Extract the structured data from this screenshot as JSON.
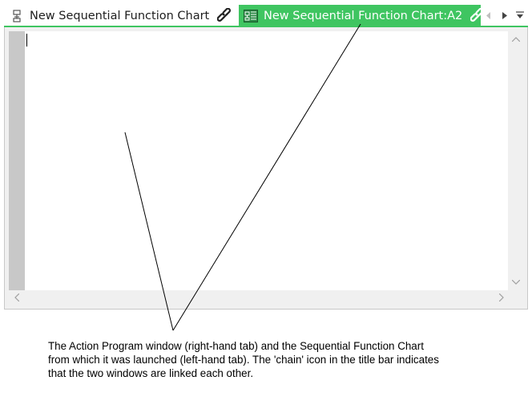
{
  "tabs": [
    {
      "label": "New Sequential Function Chart",
      "icon": "sfc-diagram-icon",
      "link_icon": "chain-link-icon",
      "active": false
    },
    {
      "label": "New Sequential Function Chart:A2",
      "icon": "action-program-icon",
      "link_icon": "chain-link-icon",
      "close_label": "✕",
      "active": true
    }
  ],
  "tab_nav": {
    "prev_icon": "chevron-left-icon",
    "next_icon": "chevron-right-icon",
    "menu_icon": "dropdown-menu-icon"
  },
  "colors": {
    "accent": "#3fc561",
    "gutter": "#c8c8c8",
    "scrollbar": "#f0f0f0"
  },
  "editor": {
    "content": ""
  },
  "caption": {
    "text": "The Action Program window (right-hand tab) and the Sequential Function Chart\nfrom which it was launched (left-hand tab). The 'chain' icon in the title bar indicates\nthat the two windows are linked each other."
  }
}
